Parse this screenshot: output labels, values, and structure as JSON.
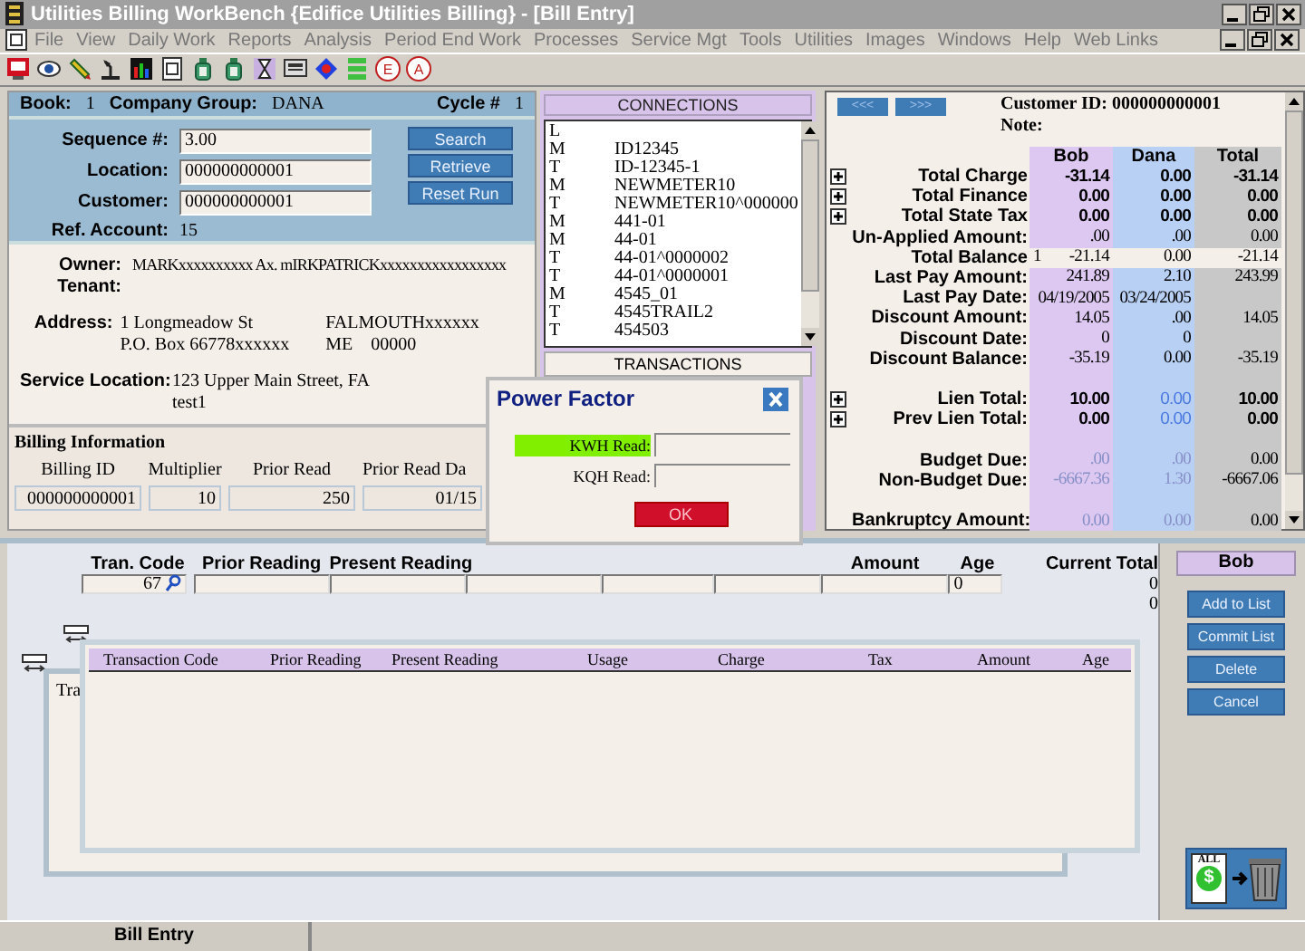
{
  "window": {
    "title": "Utilities Billing WorkBench {Edifice Utilities Billing} - [Bill Entry]"
  },
  "menu": [
    "File",
    "View",
    "Daily Work",
    "Reports",
    "Analysis",
    "Period End Work",
    "Processes",
    "Service Mgt",
    "Tools",
    "Utilities",
    "Images",
    "Windows",
    "Help",
    "Web Links"
  ],
  "toolbar": [
    {
      "kind": "monitor"
    },
    {
      "kind": "eye"
    },
    {
      "kind": "pencil"
    },
    {
      "kind": "lamp"
    },
    {
      "kind": "chart"
    },
    {
      "kind": "document"
    },
    {
      "kind": "bottle"
    },
    {
      "kind": "bottle"
    },
    {
      "kind": "hourglass"
    },
    {
      "kind": "screen"
    },
    {
      "kind": "diamond"
    },
    {
      "kind": "stack"
    },
    {
      "kind": "letter",
      "glyph": "E"
    },
    {
      "kind": "letter",
      "glyph": "A"
    }
  ],
  "book_bar": {
    "book_label": "Book:",
    "book": "1",
    "group_label": "Company Group:",
    "group": "DANA",
    "cycle_label": "Cycle #",
    "cycle": "1"
  },
  "search": {
    "fields": [
      {
        "label": "Sequence #:",
        "value": "3.00"
      },
      {
        "label": "Location:",
        "value": "000000000001"
      },
      {
        "label": "Customer:",
        "value": "000000000001"
      }
    ],
    "ref_label": "Ref. Account:",
    "ref_value": "15",
    "buttons": [
      "Search",
      "Retrieve",
      "Reset Run"
    ]
  },
  "owner": {
    "owner_label": "Owner:",
    "owner": "MARKxxxxxxxxxx Ax. mIRKPATRICKxxxxxxxxxxxxxxxxx",
    "tenant_label": "Tenant:",
    "address_label": "Address:",
    "address_lines": [
      "1 Longmeadow St",
      "P.O. Box 66778xxxxxx"
    ],
    "city": "FALMOUTHxxxxxx",
    "state": "ME",
    "zip": "00000",
    "service_label": "Service Location:",
    "service_lines": [
      "123 Upper Main Street, FA",
      "test1"
    ]
  },
  "billing_info": {
    "title": "Billing Information",
    "columns": [
      {
        "label": "Billing ID",
        "value": "000000000001"
      },
      {
        "label": "Multiplier",
        "value": "10"
      },
      {
        "label": "Prior Read",
        "value": "250"
      },
      {
        "label": "Prior Read Da",
        "value": "01/15"
      }
    ]
  },
  "connections": {
    "title": "CONNECTIONS",
    "rows": [
      {
        "type": "L"
      },
      {
        "type": "M",
        "id": "ID12345"
      },
      {
        "type": "T",
        "id": "ID-12345-1"
      },
      {
        "type": "M",
        "id": "NEWMETER10"
      },
      {
        "type": "T",
        "id": "NEWMETER10^000000"
      },
      {
        "type": "M",
        "id": "441-01"
      },
      {
        "type": "M",
        "id": "44-01"
      },
      {
        "type": "T",
        "id": "44-01^0000002"
      },
      {
        "type": "T",
        "id": "44-01^0000001"
      },
      {
        "type": "M",
        "id": "4545_01"
      },
      {
        "type": "T",
        "id": "4545TRAIL2"
      },
      {
        "type": "T",
        "id": "454503"
      }
    ],
    "transactions_tab": "TRANSACTIONS"
  },
  "account": {
    "nav": [
      "<<<",
      ">>>"
    ],
    "customer_id": "Customer ID: 000000000001",
    "note": "Note:",
    "columns": [
      {
        "name": "Bob",
        "color": "#dcc8f0"
      },
      {
        "name": "Dana",
        "color": "#b8d0f4"
      },
      {
        "name": "Total",
        "color": "#c8c8c8"
      }
    ],
    "rows": [
      {
        "kind": "bold",
        "expandable": true,
        "label": "Total Charge",
        "values": [
          "-31.14",
          "0.00",
          "-31.14"
        ]
      },
      {
        "kind": "bold",
        "expandable": true,
        "label": "Total Finance",
        "values": [
          "0.00",
          "0.00",
          "0.00"
        ]
      },
      {
        "kind": "bold",
        "expandable": true,
        "label": "Total State Tax",
        "values": [
          "0.00",
          "0.00",
          "0.00"
        ]
      },
      {
        "kind": "normal",
        "expandable": false,
        "label": "Un-Applied Amount:",
        "values": [
          ".00",
          ".00",
          "0.00"
        ]
      },
      {
        "kind": "highlight",
        "expandable": false,
        "label": "Total Balance",
        "marker": "1",
        "values": [
          "-21.14",
          "0.00",
          "-21.14"
        ]
      },
      {
        "kind": "normal",
        "expandable": false,
        "label": "Last Pay Amount:",
        "values": [
          "241.89",
          "2.10",
          "243.99"
        ]
      },
      {
        "kind": "normal",
        "expandable": false,
        "label": "Last Pay Date:",
        "values": [
          "04/19/2005",
          "03/24/2005"
        ]
      },
      {
        "kind": "normal",
        "expandable": false,
        "label": "Discount Amount:",
        "values": [
          "14.05",
          ".00",
          "14.05"
        ]
      },
      {
        "kind": "normal",
        "expandable": false,
        "label": "Discount Date:",
        "values": [
          "0",
          "0"
        ]
      },
      {
        "kind": "normal",
        "expandable": false,
        "label": "Discount Balance:",
        "values": [
          "-35.19",
          "0.00",
          "-35.19"
        ]
      },
      {
        "kind": "gap"
      },
      {
        "kind": "lien",
        "expandable": true,
        "label": "Lien Total:",
        "values": [
          "10.00",
          "0.00",
          "10.00"
        ]
      },
      {
        "kind": "lien",
        "expandable": true,
        "label": "Prev Lien Total:",
        "values": [
          "0.00",
          "0.00",
          "0.00"
        ]
      },
      {
        "kind": "gap"
      },
      {
        "kind": "faint",
        "expandable": false,
        "label": "Budget Due:",
        "values": [
          ".00",
          ".00",
          "0.00"
        ]
      },
      {
        "kind": "faint",
        "expandable": false,
        "label": "Non-Budget Due:",
        "values": [
          "-6667.36",
          "1.30",
          "-6667.06"
        ]
      },
      {
        "kind": "gap"
      },
      {
        "kind": "faint",
        "expandable": false,
        "label": "Bankruptcy Amount:",
        "values": [
          "0.00",
          "0.00",
          "0.00"
        ]
      }
    ]
  },
  "entry": {
    "fields": [
      {
        "label": "Tran. Code",
        "value": "67",
        "kind": "lookup"
      },
      {
        "label": "Prior Reading",
        "kind": "text"
      },
      {
        "label": "Present Reading",
        "kind": "text"
      },
      {
        "kind": "text"
      },
      {
        "kind": "text"
      },
      {
        "kind": "text"
      },
      {
        "label": "Amount",
        "kind": "text"
      },
      {
        "label": "Age",
        "value": "0",
        "kind": "text"
      }
    ],
    "total_label": "Current Total",
    "totals": [
      "0",
      "0"
    ]
  },
  "grid": {
    "columns": [
      "Transaction Code",
      "Prior Reading",
      "Present Reading",
      "Usage",
      "Charge",
      "Tax",
      "Amount",
      "Age"
    ],
    "back_label": "Tra"
  },
  "side": {
    "customer": "Bob",
    "buttons": [
      "Add to List",
      "Commit List",
      "Delete",
      "Cancel"
    ],
    "clear_label": "ALL",
    "clear_symbol": "$"
  },
  "dialog": {
    "title": "Power Factor",
    "fields": [
      {
        "label": "KWH Read:",
        "highlighted": true
      },
      {
        "label": "KQH Read:",
        "highlighted": false
      }
    ],
    "button": "OK"
  },
  "status_bar": [
    "Bill Entry"
  ]
}
